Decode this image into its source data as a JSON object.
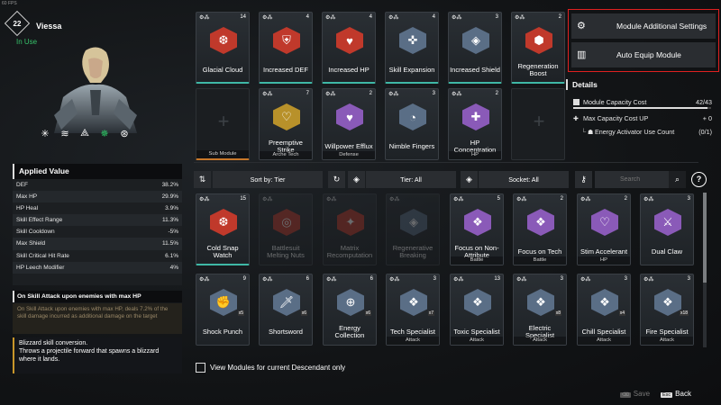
{
  "fps": "60 FPS",
  "character": {
    "level": "22",
    "name": "Viessa",
    "status": "In Use"
  },
  "skill_icons": [
    "snowflake-icon",
    "wave-icon",
    "ice-spike-icon",
    "blizzard-icon",
    "orbit-icon"
  ],
  "applied_value": {
    "title": "Applied Value",
    "rows": [
      {
        "label": "DEF",
        "value": "38.2%"
      },
      {
        "label": "Max HP",
        "value": "29.9%"
      },
      {
        "label": "HP Heal",
        "value": "3.9%"
      },
      {
        "label": "Skill Effect Range",
        "value": "11.3%"
      },
      {
        "label": "Skill Cooldown",
        "value": "-5%"
      },
      {
        "label": "Max Shield",
        "value": "11.5%"
      },
      {
        "label": "Skill Critical Hit Rate",
        "value": "6.1%"
      },
      {
        "label": "HP Leech Modifier",
        "value": "4%"
      }
    ]
  },
  "on_skill_attack": {
    "title": "On Skill Attack upon enemies with max HP",
    "desc": "On Skill Attack upon enemies with max HP, deals 7.2% of the skill damage incurred as additional damage on the target"
  },
  "blizzard": {
    "line1": "Blizzard skill conversion.",
    "line2": "Throws a projectile forward that spawns a blizzard where it lands."
  },
  "equipped_row1": [
    {
      "name": "Glacial Cloud",
      "cost": "14",
      "color": "#c0392b",
      "glyph": "❆"
    },
    {
      "name": "Increased DEF",
      "cost": "4",
      "color": "#c0392b",
      "glyph": "⛨"
    },
    {
      "name": "Increased HP",
      "cost": "4",
      "color": "#c0392b",
      "glyph": "♥"
    },
    {
      "name": "Skill Expansion",
      "cost": "4",
      "color": "#5a6e86",
      "glyph": "✜"
    },
    {
      "name": "Increased Shield",
      "cost": "3",
      "color": "#5a6e86",
      "glyph": "◈"
    },
    {
      "name": "Regeneration Boost",
      "cost": "2",
      "color": "#c0392b",
      "glyph": "⬢"
    }
  ],
  "equipped_row2": [
    {
      "name": "",
      "sub": "Sub Module",
      "empty": true
    },
    {
      "name": "Preemptive Strike",
      "sub": "Arche Tech",
      "cost": "7",
      "color": "#b8912a",
      "glyph": "♡"
    },
    {
      "name": "Willpower Efflux",
      "sub": "Defense",
      "cost": "2",
      "color": "#8a5ab8",
      "glyph": "♥"
    },
    {
      "name": "Nimble Fingers",
      "sub": "",
      "cost": "3",
      "color": "#5a6e86",
      "glyph": "◔"
    },
    {
      "name": "HP Concentration",
      "sub": "HP",
      "cost": "2",
      "color": "#8a5ab8",
      "glyph": "✚"
    },
    {
      "name": "",
      "sub": "",
      "empty": true
    }
  ],
  "filters": {
    "sort": "Sort by: Tier",
    "tier": "Tier: All",
    "socket": "Socket: All",
    "search_placeholder": "Search"
  },
  "inventory_row1": [
    {
      "name": "Cold Snap Watch",
      "sub": "",
      "cost": "15",
      "color": "#c0392b",
      "glyph": "❆",
      "dim": false
    },
    {
      "name": "Battlesuit Melting Nuts",
      "sub": "",
      "cost": "",
      "color": "#c0392b",
      "glyph": "◎",
      "dim": true
    },
    {
      "name": "Matrix Recomputation",
      "sub": "",
      "cost": "",
      "color": "#c0392b",
      "glyph": "✦",
      "dim": true
    },
    {
      "name": "Regenerative Breaking",
      "sub": "",
      "cost": "",
      "color": "#5a6e86",
      "glyph": "◈",
      "dim": true
    },
    {
      "name": "Focus on Non-Attribute",
      "sub": "Battle",
      "cost": "5",
      "color": "#8a5ab8",
      "glyph": "❖",
      "dim": false
    },
    {
      "name": "Focus on Tech",
      "sub": "Battle",
      "cost": "2",
      "color": "#8a5ab8",
      "glyph": "❖",
      "dim": false
    },
    {
      "name": "Stim Accelerant",
      "sub": "HP",
      "cost": "2",
      "color": "#8a5ab8",
      "glyph": "♡",
      "dim": false
    },
    {
      "name": "Dual Claw",
      "sub": "",
      "cost": "3",
      "color": "#8a5ab8",
      "glyph": "⚔",
      "dim": false
    }
  ],
  "inventory_row2": [
    {
      "name": "Shock Punch",
      "sub": "",
      "cost": "9",
      "count": "x5",
      "color": "#5a6e86",
      "glyph": "✊"
    },
    {
      "name": "Shortsword",
      "sub": "",
      "cost": "6",
      "count": "x6",
      "color": "#5a6e86",
      "glyph": "🗡"
    },
    {
      "name": "Energy Collection",
      "sub": "",
      "cost": "6",
      "count": "x6",
      "color": "#5a6e86",
      "glyph": "⊕"
    },
    {
      "name": "Tech Specialist",
      "sub": "Attack",
      "cost": "3",
      "count": "x7",
      "color": "#5a6e86",
      "glyph": "❖"
    },
    {
      "name": "Toxic Specialist",
      "sub": "Attack",
      "cost": "13",
      "count": "",
      "color": "#5a6e86",
      "glyph": "❖"
    },
    {
      "name": "Electric Specialist",
      "sub": "Attack",
      "cost": "3",
      "count": "x8",
      "color": "#5a6e86",
      "glyph": "❖"
    },
    {
      "name": "Chill Specialist",
      "sub": "Attack",
      "cost": "3",
      "count": "x4",
      "color": "#5a6e86",
      "glyph": "❖"
    },
    {
      "name": "Fire Specialist",
      "sub": "Attack",
      "cost": "3",
      "count": "x18",
      "color": "#5a6e86",
      "glyph": "❖"
    }
  ],
  "right": {
    "btn1": "Module Additional Settings",
    "btn2": "Auto Equip Module",
    "details": "Details",
    "cap_label": "Module Capacity Cost",
    "cap_value": "42/43",
    "cap_fraction": 0.977,
    "maxcap_label": "Max Capacity Cost UP",
    "maxcap_value": "+ 0",
    "energy_label": "Energy Activator Use Count",
    "energy_value": "(0/1)"
  },
  "footer": {
    "checkbox_label": "View Modules for current Descendant only",
    "save": "Save",
    "back": "Back",
    "save_key": "⌫",
    "back_key": "Esc"
  }
}
